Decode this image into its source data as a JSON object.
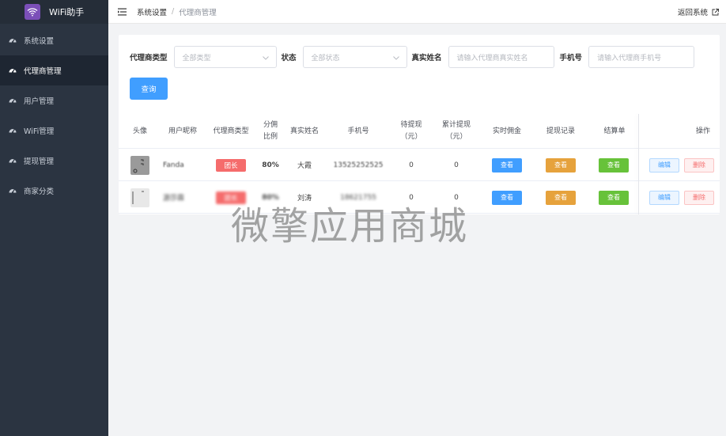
{
  "app": {
    "title": "WiFi助手"
  },
  "sidebar": {
    "items": [
      {
        "label": "系统设置",
        "icon": "dashboard-icon",
        "active": false
      },
      {
        "label": "代理商管理",
        "icon": "dashboard-icon",
        "active": true
      },
      {
        "label": "用户管理",
        "icon": "dashboard-icon",
        "active": false
      },
      {
        "label": "WiFi管理",
        "icon": "dashboard-icon",
        "active": false
      },
      {
        "label": "提现管理",
        "icon": "dashboard-icon",
        "active": false
      },
      {
        "label": "商家分类",
        "icon": "dashboard-icon",
        "active": false
      }
    ]
  },
  "header": {
    "breadcrumb_home": "系统设置",
    "breadcrumb_sep": "/",
    "breadcrumb_current": "代理商管理",
    "back_label": "返回系统"
  },
  "filters": {
    "agent_type_label": "代理商类型",
    "agent_type_value": "全部类型",
    "status_label": "状态",
    "status_value": "全部状态",
    "realname_label": "真实姓名",
    "realname_placeholder": "请输入代理商真实姓名",
    "phone_label": "手机号",
    "phone_placeholder": "请输入代理商手机号",
    "query_button": "查询"
  },
  "table": {
    "headers": {
      "avatar": "头像",
      "nickname": "用户昵称",
      "agent_type": "代理商类型",
      "commission_l1": "分佣",
      "commission_l2": "比例",
      "realname": "真实姓名",
      "phone": "手机号",
      "pending_l1": "待提现",
      "pending_l2": "（元）",
      "total_l1": "累计提现",
      "total_l2": "（元）",
      "realtime": "实时佣金",
      "records": "提现记录",
      "statement": "结算单",
      "actions": "操作"
    },
    "rows": [
      {
        "nickname": "Fanda",
        "agent_type": "团长",
        "commission": "80%",
        "realname": "大霞",
        "phone": "13525252525",
        "pending": "0",
        "total": "0",
        "view_realtime": "查看",
        "view_records": "查看",
        "view_statement": "查看",
        "edit": "编辑",
        "delete": "删除"
      },
      {
        "nickname": "源莎霖",
        "agent_type": "团长",
        "commission": "80%",
        "realname": "刘涛",
        "phone": "18621755",
        "pending": "0",
        "total": "0",
        "view_realtime": "查看",
        "view_records": "查看",
        "view_statement": "查看",
        "edit": "编辑",
        "delete": "删除"
      }
    ]
  },
  "watermark": "微擎应用商城",
  "colors": {
    "sidebar_bg": "#2b3441",
    "primary": "#409eff",
    "danger": "#f56c6c",
    "warning": "#e6a23c",
    "success": "#67c23a",
    "logo_bg": "#7b4fb8"
  }
}
